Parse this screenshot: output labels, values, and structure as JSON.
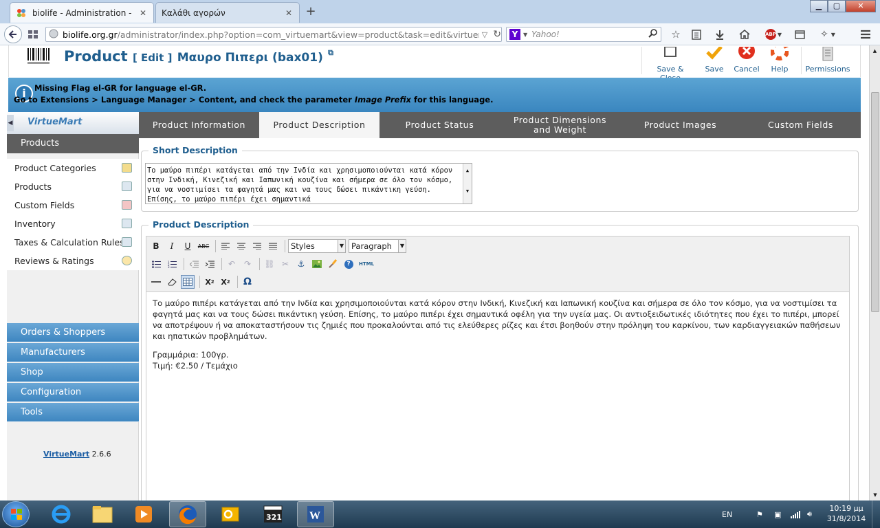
{
  "browser": {
    "tabs": [
      {
        "title": "biolife - Administration - ...",
        "active": true
      },
      {
        "title": "Καλάθι αγορών",
        "active": false
      }
    ],
    "new_tab": "+",
    "window_buttons": {
      "minimize": "▁",
      "maximize": "▢",
      "close": "✕"
    },
    "url_host": "biolife.org.gr",
    "url_rest": "/administrator/index.php?option=com_virtuemart&view=product&task=edit&virtuemart_product_id",
    "search_engine": "Y",
    "search_placeholder": "Yahoo!",
    "adblock_label": "ABP"
  },
  "toolbar": {
    "title": "Product",
    "edit_label": "[ Edit ]",
    "product_name": "Μαυρο Πιπερι (bax01)",
    "buttons": [
      {
        "label": "Save & Close"
      },
      {
        "label": "Save"
      },
      {
        "label": "Cancel"
      },
      {
        "label": "Help"
      },
      {
        "label": "Permissions"
      }
    ]
  },
  "message": {
    "line1": "Missing Flag el-GR for language el-GR.",
    "line2_prefix": "Go to Extensions > Language Manager > Content, and check the parameter ",
    "line2_em": "Image Prefix",
    "line2_suffix": " for this language."
  },
  "sidebar": {
    "logo_text": "VirtueMart",
    "products_header": "Products",
    "items": [
      {
        "label": "Product Categories"
      },
      {
        "label": "Products"
      },
      {
        "label": "Custom Fields"
      },
      {
        "label": "Inventory"
      },
      {
        "label": "Taxes & Calculation Rules"
      },
      {
        "label": "Reviews & Ratings"
      }
    ],
    "groups": [
      {
        "label": "Orders & Shoppers"
      },
      {
        "label": "Manufacturers"
      },
      {
        "label": "Shop"
      },
      {
        "label": "Configuration"
      },
      {
        "label": "Tools"
      }
    ],
    "version_link": "VirtueMart",
    "version_number": " 2.6.6"
  },
  "tabs": [
    {
      "label": "Product Information",
      "active": false
    },
    {
      "label": "Product Description",
      "active": true
    },
    {
      "label": "Product Status",
      "active": false
    },
    {
      "label": "Product Dimensions and Weight",
      "active": false
    },
    {
      "label": "Product Images",
      "active": false
    },
    {
      "label": "Custom Fields",
      "active": false
    }
  ],
  "short_description": {
    "legend": "Short Description",
    "value": "Το μαύρο πιπέρι κατάγεται από την Ινδία και χρησιμοποιούνται κατά κόρον στην Ινδική, Κινεζική και Ιαπωνική κουζίνα και σήμερα σε όλο τον κόσμο, για να νοστιμίσει τα φαγητά μας και να τους δώσει πικάντικη γεύση. Επίσης, το μαύρο πιπέρι έχει σημαντικά"
  },
  "product_description": {
    "legend": "Product Description",
    "styles_value": "Styles",
    "format_value": "Paragraph",
    "html_label": "HTML",
    "paragraph": "Το μαύρο πιπέρι κατάγεται από την Ινδία και χρησιμοποιούνται κατά κόρον στην Ινδική, Κινεζική και Ιαπωνική κουζίνα και σήμερα σε όλο τον κόσμο, για να νοστιμίσει τα φαγητά μας και να τους δώσει πικάντικη γεύση. Επίσης, το μαύρο πιπέρι έχει σημαντικά οφέλη για την υγεία μας. Οι αντιοξειδωτικές ιδιότητες που έχει το πιπέρι, μπορεί να αποτρέψουν ή να αποκαταστήσουν τις ζημιές που προκαλούνται από τις ελεύθερες ρίζες και έτσι βοηθούν στην πρόληψη του καρκίνου, των καρδιαγγειακών παθήσεων και ηπατικών προβλημάτων.",
    "line_weight": "Γραμμάρια: 100γρ.",
    "line_price": "Τιμή: €2.50 / Τεμάχιο"
  },
  "taskbar": {
    "language": "EN",
    "time": "10:19 μμ",
    "date": "31/8/2014"
  }
}
